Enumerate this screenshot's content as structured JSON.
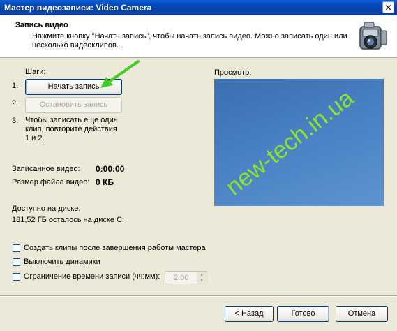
{
  "window": {
    "title": "Мастер видеозаписи: Video Camera",
    "close_glyph": "✕"
  },
  "header": {
    "title": "Запись видео",
    "description": "Нажмите кнопку \"Начать запись\", чтобы начать запись видео. Можно записать один или несколько видеоклипов."
  },
  "steps": {
    "label": "Шаги:",
    "n1": "1.",
    "n2": "2.",
    "n3": "3.",
    "start_button": "Начать запись",
    "stop_button": "Остановить запись",
    "step3_text": "Чтобы записать еще один клип, повторите действия 1 и 2."
  },
  "stats": {
    "recorded_label": "Записанное видео:",
    "recorded_value": "0:00:00",
    "size_label": "Размер файла видео:",
    "size_value": "0 КБ",
    "disk_label": "Доступно на диске:",
    "disk_value": "181,52 ГБ осталось на диске C:"
  },
  "preview": {
    "label": "Просмотр:",
    "watermark": "new-tech.in.ua"
  },
  "options": {
    "create_clips": "Создать клипы после завершения работы мастера",
    "mute_speakers": "Выключить динамики",
    "time_limit": "Ограничение времени записи (чч:мм):",
    "time_value": "2:00"
  },
  "footer": {
    "back": "< Назад",
    "finish": "Готово",
    "cancel": "Отмена"
  },
  "colors": {
    "arrow": "#44cc22",
    "watermark": "#8de22c",
    "titlebar": "#0a4fc4"
  },
  "icons": {
    "camera": "video-camera-icon",
    "arrow": "green-arrow-annotation"
  }
}
